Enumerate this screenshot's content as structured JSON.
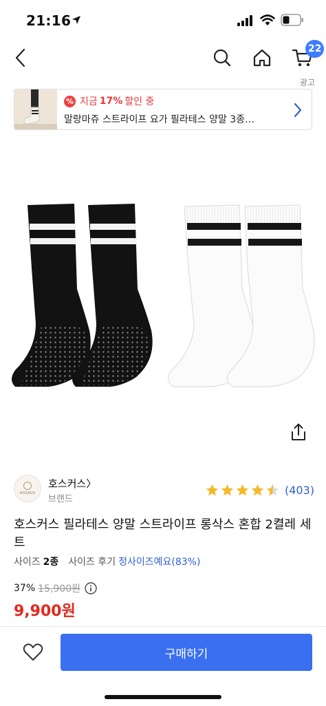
{
  "status_bar": {
    "time": "21:16",
    "icons": [
      "location-arrow-icon",
      "cellular-signal-icon",
      "wifi-icon",
      "battery-icon"
    ]
  },
  "nav": {
    "icons": [
      "back-arrow-icon",
      "search-icon",
      "home-icon",
      "cart-icon"
    ],
    "cart_count": "22"
  },
  "ad": {
    "label": "광고",
    "deal_prefix": "지금",
    "deal_percent": "17%",
    "deal_suffix": "할인 중",
    "title": "말랑마쥬 스트라이프 요가 필라테스 양말 3종…"
  },
  "product": {
    "brand": {
      "name": "호스커스〉",
      "subtitle": "브랜드",
      "logo_text": "HOSKUS"
    },
    "rating": {
      "stars": 4.5,
      "review_count": "(403)"
    },
    "title": "호스커스 필라테스 양말 스트라이프 롱삭스 혼합 2켤레 세트",
    "size": {
      "label": "사이즈",
      "count": "2종",
      "review_label": "사이즈 후기",
      "review_result": "정사이즈예요(83%)"
    },
    "price": {
      "discount": "37%",
      "original": "15,900원",
      "sale": "9,900원"
    }
  },
  "bottom": {
    "buy_label": "구매하기"
  },
  "colors": {
    "accent": "#3a6ff0",
    "badge": "#3d7dff",
    "sale_red": "#e2281f",
    "star": "#f5b92a",
    "link_blue": "#2e5fd1"
  }
}
